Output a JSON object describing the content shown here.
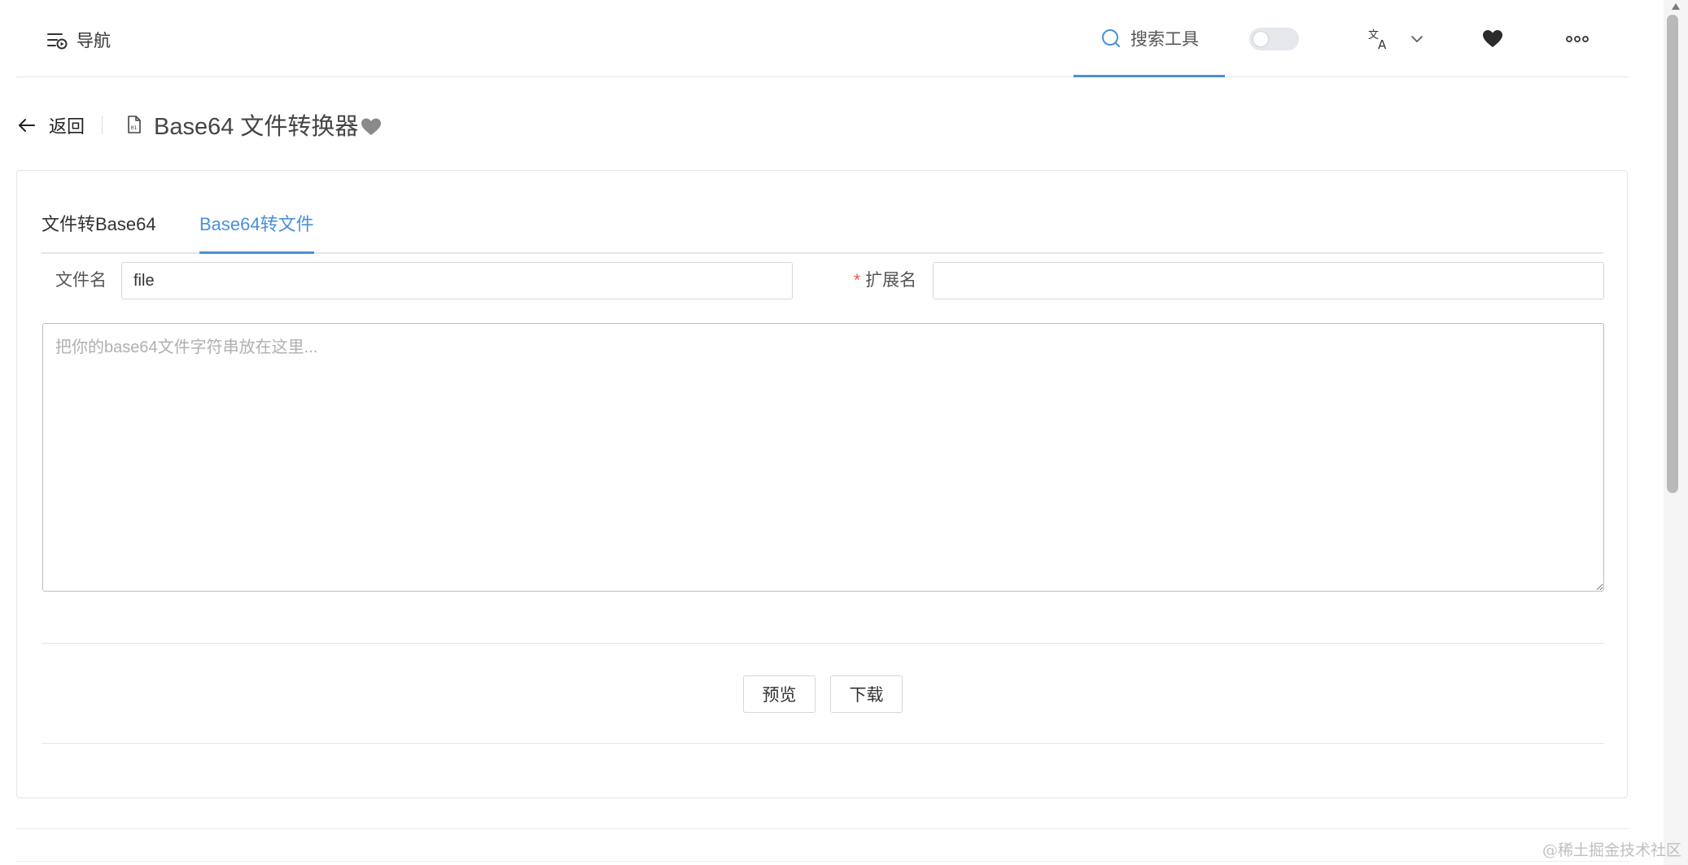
{
  "header": {
    "nav_label": "导航",
    "search_label": "搜索工具",
    "theme_switch_on": false,
    "icons": [
      "menu-play-icon",
      "search-icon",
      "translate-icon",
      "chevron-down-icon",
      "heart-icon",
      "more-icon"
    ]
  },
  "title_bar": {
    "back_label": "返回",
    "tool_title": "Base64 文件转换器",
    "icons": [
      "arrow-left-icon",
      "file-binary-icon",
      "heart-icon"
    ]
  },
  "tabs": [
    {
      "label": "文件转Base64",
      "active": false
    },
    {
      "label": "Base64转文件",
      "active": true
    }
  ],
  "form": {
    "filename_label": "文件名",
    "filename_value": "file",
    "extension_label": "扩展名",
    "extension_required_mark": "*",
    "extension_value": "",
    "base64_placeholder": "把你的base64文件字符串放在这里..."
  },
  "actions": {
    "preview_label": "预览",
    "download_label": "下载"
  },
  "watermark": "@稀土掘金技术社区",
  "colors": {
    "accent": "#4a90d9",
    "required": "#e45649",
    "border": "#d7d7d7"
  }
}
